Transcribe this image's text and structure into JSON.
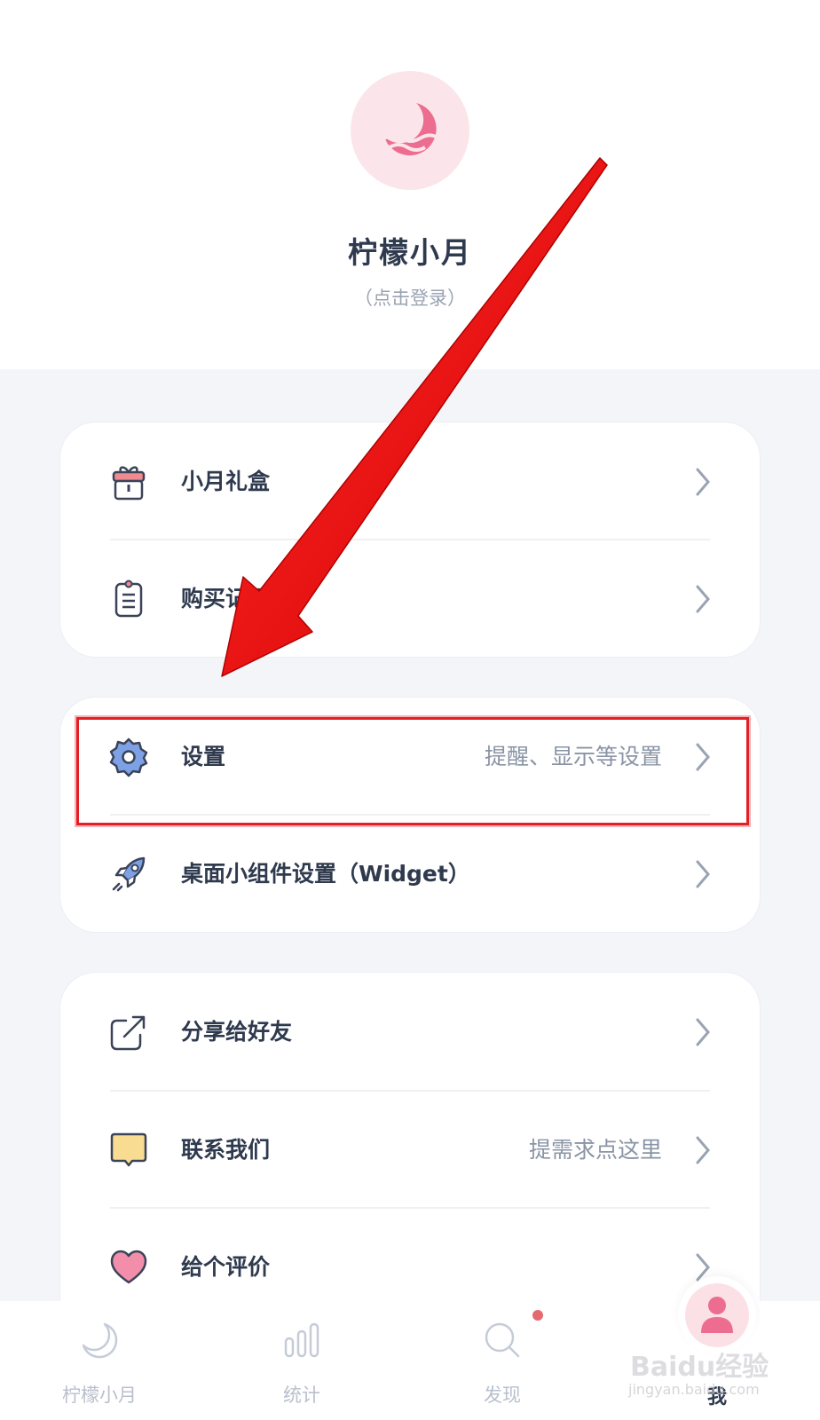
{
  "profile": {
    "title": "柠檬小月",
    "login_hint": "（点击登录）"
  },
  "menu_group_1": [
    {
      "label": "小月礼盒",
      "icon": "gift-box-icon"
    },
    {
      "label": "购买记录",
      "icon": "clipboard-icon"
    }
  ],
  "menu_group_2": [
    {
      "label": "设置",
      "hint": "提醒、显示等设置",
      "icon": "gear-icon"
    },
    {
      "label": "桌面小组件设置（Widget）",
      "icon": "rocket-icon"
    }
  ],
  "menu_group_3": [
    {
      "label": "分享给好友",
      "icon": "share-icon"
    },
    {
      "label": "联系我们",
      "hint": "提需求点这里",
      "icon": "message-icon"
    },
    {
      "label": "给个评价",
      "icon": "heart-icon"
    }
  ],
  "tabbar": [
    {
      "label": "柠檬小月",
      "icon": "moon-icon",
      "active": false
    },
    {
      "label": "统计",
      "icon": "stats-icon",
      "active": false
    },
    {
      "label": "发现",
      "icon": "search-icon",
      "active": false,
      "badge": true
    },
    {
      "label": "我",
      "icon": "person-icon",
      "active": true
    }
  ],
  "watermark": {
    "text": "Baidu经验",
    "sub": "jingyan.baidu.com"
  },
  "colors": {
    "accent_pink": "#ec6d8f",
    "annotation_red": "#e41f26",
    "page_bg": "#f4f5f9"
  }
}
